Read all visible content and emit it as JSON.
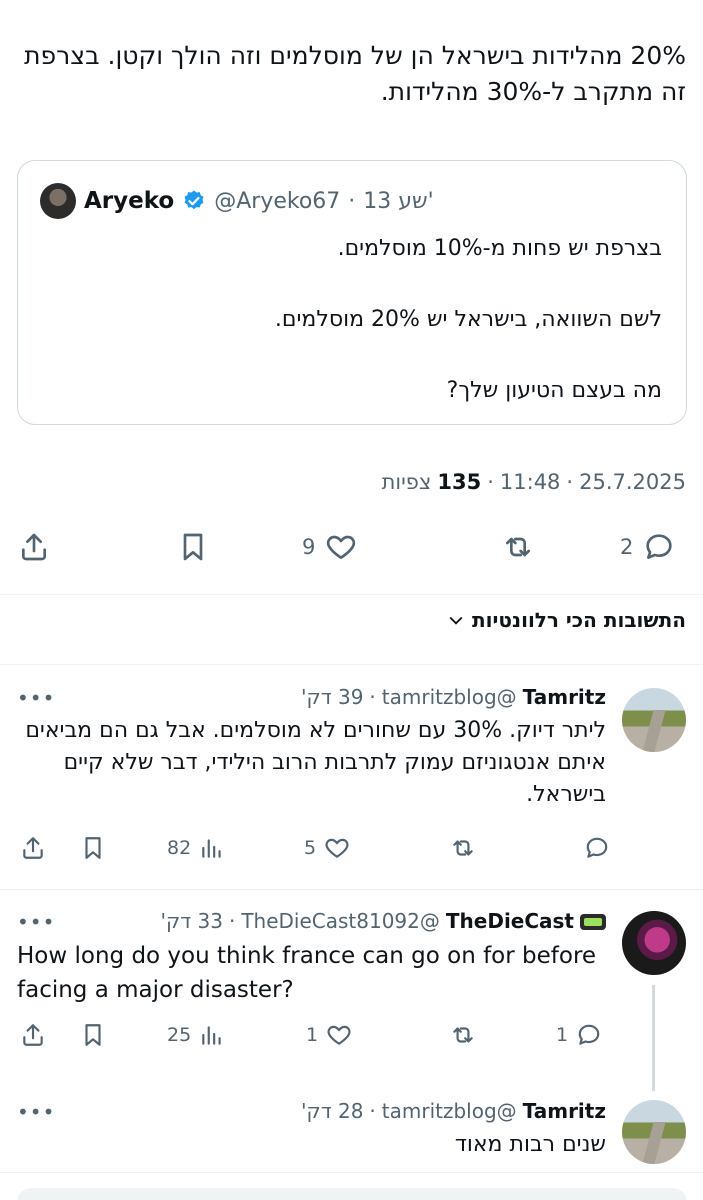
{
  "tweet": {
    "text": "20% מהלידות בישראל הן של מוסלמים וזה הולך וקטן. בצרפת זה מתקרב ל-30% מהלידות.",
    "date": "25.7.2025",
    "time": "11:48",
    "views_count": "135",
    "views_label": "צפיות",
    "separator": "·"
  },
  "quoted_tweet": {
    "name": "Aryeko",
    "handle": "@Aryeko67",
    "time": "13 שע'",
    "lines": [
      "בצרפת יש פחות מ-10% מוסלמים.",
      "לשם השוואה, בישראל יש 20% מוסלמים.",
      "מה בעצם הטיעון שלך?"
    ]
  },
  "actions": {
    "replies": "2",
    "reposts": "",
    "likes": "9"
  },
  "relevant_replies_label": "התשובות הכי רלוונטיות",
  "replies": [
    {
      "name": "Tamritz",
      "handle": "@tamritzblog",
      "time": "39 דק'",
      "text": "ליתר דיוק. 30% עם שחורים לא מוסלמים. אבל גם הם מביאים איתם אנטגוניזם עמוק לתרבות הרוב הילידי, דבר שלא קיים בישראל.",
      "views": "82",
      "likes": "5",
      "replies": ""
    },
    {
      "name": "TheDieCast",
      "handle": "@TheDieCast81092",
      "time": "33 דק'",
      "text": "How long do you think france can go on for before facing a major disaster?",
      "views": "25",
      "likes": "1",
      "replies": "1"
    },
    {
      "name": "Tamritz",
      "handle": "@tamritzblog",
      "time": "28 דק'",
      "text": "שנים רבות מאוד"
    }
  ],
  "more_glyph": "•••",
  "icons": {
    "verified": "verified-badge-icon",
    "reply": "speech-bubble-icon",
    "repost": "repost-arrows-icon",
    "like": "heart-icon",
    "bookmark": "bookmark-icon",
    "share": "share-upload-icon",
    "views": "bar-chart-icon"
  },
  "colors": {
    "verified_blue": "#1d9bf0",
    "muted_text": "#536471",
    "border": "#cfd9de"
  }
}
